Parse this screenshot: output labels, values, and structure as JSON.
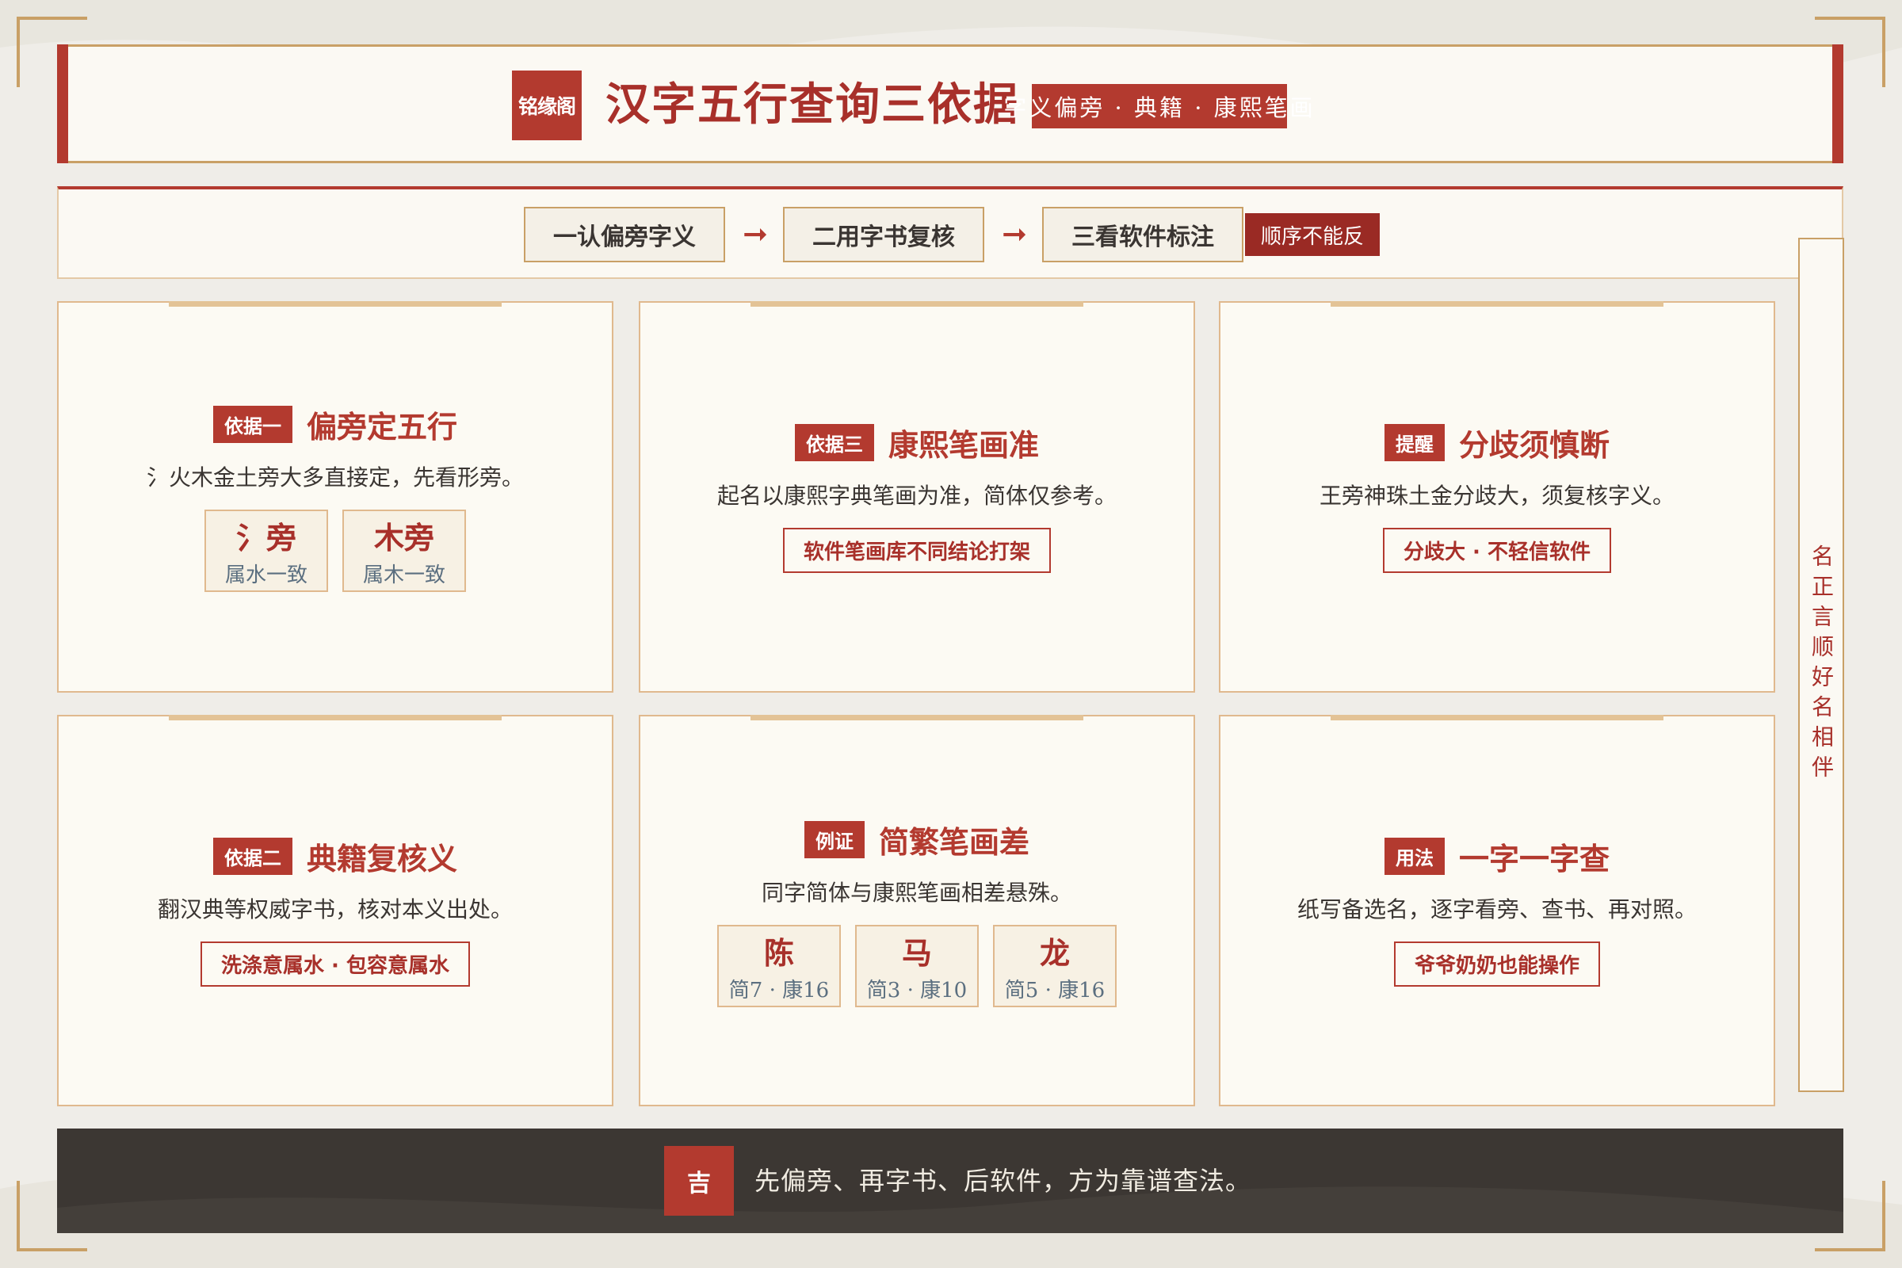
{
  "header": {
    "seal": "铭缘阁",
    "title": "汉字五行查询三依据",
    "subtitle": "字义偏旁 · 典籍 · 康熙笔画"
  },
  "steps": {
    "items": [
      "一认偏旁字义",
      "二用字书复核",
      "三看软件标注"
    ],
    "arrow": "➞",
    "order_tag": "顺序不能反"
  },
  "side_text": "名正言顺好名相伴",
  "cards": [
    {
      "tag": "依据一",
      "title": "偏旁定五行",
      "desc": "氵火木金土旁大多直接定，先看形旁。",
      "boxes": [
        {
          "big": "氵旁",
          "small": "属水一致"
        },
        {
          "big": "木旁",
          "small": "属木一致"
        }
      ]
    },
    {
      "tag": "依据三",
      "title": "康熙笔画准",
      "desc": "起名以康熙字典笔画为准，简体仅参考。",
      "pill": "软件笔画库不同结论打架"
    },
    {
      "tag": "提醒",
      "title": "分歧须慎断",
      "desc": "王旁神珠土金分歧大，须复核字义。",
      "pill": "分歧大 · 不轻信软件"
    },
    {
      "tag": "依据二",
      "title": "典籍复核义",
      "desc": "翻汉典等权威字书，核对本义出处。",
      "pill": "洗涤意属水 · 包容意属水"
    },
    {
      "tag": "例证",
      "title": "简繁笔画差",
      "desc": "同字简体与康熙笔画相差悬殊。",
      "boxes": [
        {
          "big": "陈",
          "small": "简7 · 康16"
        },
        {
          "big": "马",
          "small": "简3 · 康10"
        },
        {
          "big": "龙",
          "small": "简5 · 康16"
        }
      ]
    },
    {
      "tag": "用法",
      "title": "一字一字查",
      "desc": "纸写备选名，逐字看旁、查书、再对照。",
      "pill": "爷爷奶奶也能操作"
    }
  ],
  "footer": {
    "badge": "吉",
    "text": "先偏旁、再字书、后软件，方为靠谱查法。"
  },
  "colors": {
    "accent": "#b33a2f",
    "gold": "#c9a066",
    "paper": "#fbf9f3",
    "dark": "#3c3733"
  }
}
